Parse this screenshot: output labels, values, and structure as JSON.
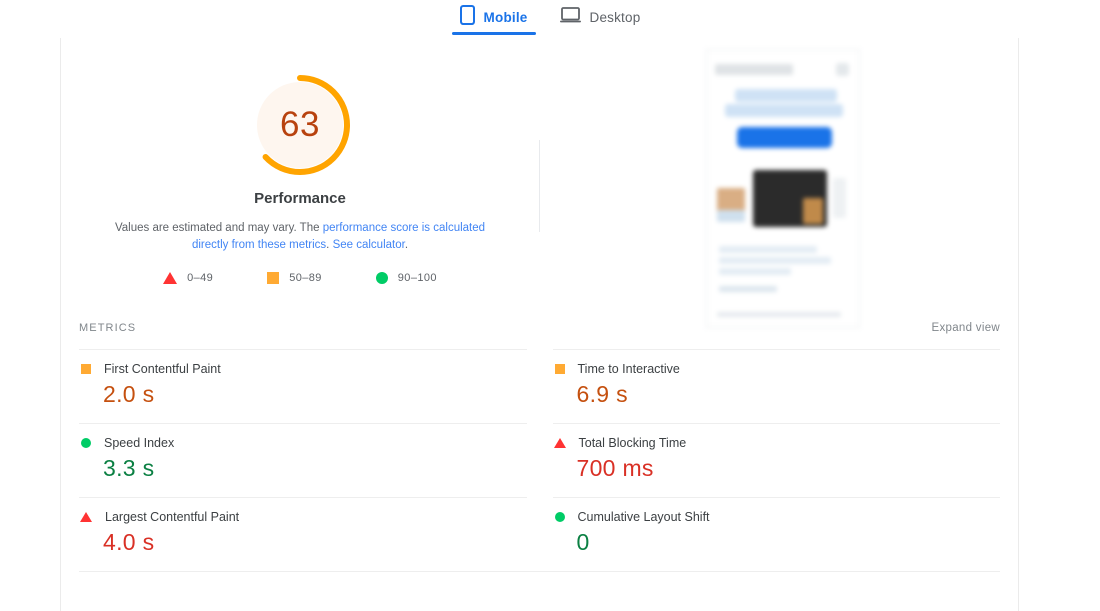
{
  "tabs": [
    {
      "label": "Mobile",
      "icon": "mobile-phone-icon",
      "active": true
    },
    {
      "label": "Desktop",
      "icon": "laptop-icon",
      "active": false
    }
  ],
  "score": {
    "value": "63",
    "title": "Performance",
    "description_part1": "Values are estimated and may vary. The ",
    "description_link1": "performance score is calculated directly from these metrics",
    "description_part2": ". ",
    "description_link2": "See calculator",
    "description_part3": ".",
    "arc_color": "#ffa400",
    "track_color": "#fef6ef",
    "value_color": "#b8420e"
  },
  "legend": [
    {
      "icon": "triangle-icon",
      "label": "0–49",
      "color": "#ff3333"
    },
    {
      "icon": "square-icon",
      "label": "50–89",
      "color": "#ffaa33"
    },
    {
      "icon": "circle-icon",
      "label": "90–100",
      "color": "#00cc66"
    }
  ],
  "metrics_header": {
    "label": "METRICS",
    "expand_view": "Expand view"
  },
  "metrics": {
    "left": [
      {
        "icon": "square-icon",
        "name": "First Contentful Paint",
        "value": "2.0 s",
        "value_class": "v-amber"
      },
      {
        "icon": "circle-icon",
        "name": "Speed Index",
        "value": "3.3 s",
        "value_class": "v-green"
      },
      {
        "icon": "triangle-icon",
        "name": "Largest Contentful Paint",
        "value": "4.0 s",
        "value_class": "v-red"
      }
    ],
    "right": [
      {
        "icon": "square-icon",
        "name": "Time to Interactive",
        "value": "6.9 s",
        "value_class": "v-amber"
      },
      {
        "icon": "triangle-icon",
        "name": "Total Blocking Time",
        "value": "700 ms",
        "value_class": "v-red"
      },
      {
        "icon": "circle-icon",
        "name": "Cumulative Layout Shift",
        "value": "0",
        "value_class": "v-green"
      }
    ]
  },
  "thumbnail": {
    "alt": "blurred mobile page screenshot"
  }
}
